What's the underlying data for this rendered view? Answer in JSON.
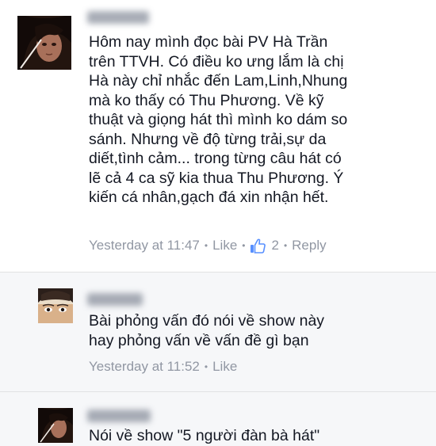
{
  "comments": [
    {
      "text": "Hôm nay mình đọc bài PV Hà Trần\ntrên TTVH. Có điều ko ưng lắm là chị\nHà này chỉ nhắc đến Lam,Linh,Nhung\nmà ko thấy có Thu Phương. Về kỹ\nthuật và giọng hát thì mình ko dám so\nsánh. Nhưng về độ từng trải,sự da\ndiết,tình cảm... trong từng câu hát có\nlẽ cả 4 ca sỹ kia thua Thu Phương. Ý\nkiến cá nhân,gạch đá xin nhận hết.",
      "time": "Yesterday at 11:47",
      "like_label": "Like",
      "like_count": "2",
      "reply_label": "Reply"
    },
    {
      "text": "Bài phỏng vấn đó nói về show này\nhay phỏng vấn về vấn đề gì bạn",
      "time": "Yesterday at 11:52",
      "like_label": "Like"
    },
    {
      "text": "Nói về show \"5 người đàn bà hát\""
    }
  ],
  "icons": {
    "like": "thumbs-up-icon",
    "separator": "middle-dot"
  },
  "colors": {
    "text": "#141823",
    "meta": "#9197a3",
    "like_icon": "#5890ff",
    "reply_background": "#f6f7f9"
  }
}
